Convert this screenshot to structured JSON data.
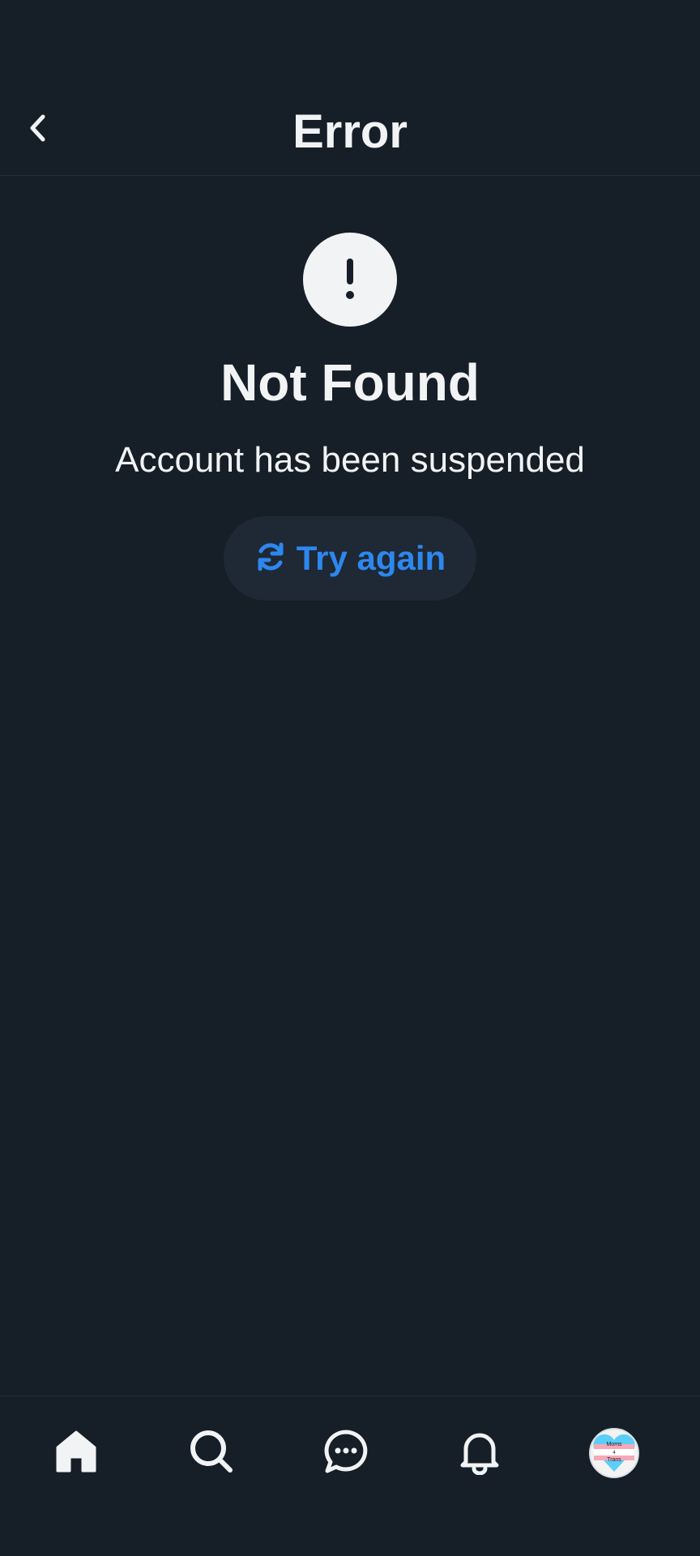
{
  "header": {
    "title": "Error"
  },
  "error": {
    "heading": "Not Found",
    "message": "Account has been suspended",
    "retry_label": "Try again"
  },
  "nav": {
    "items": [
      {
        "name": "home",
        "icon": "home-icon"
      },
      {
        "name": "search",
        "icon": "search-icon"
      },
      {
        "name": "messages",
        "icon": "chat-bubble-icon"
      },
      {
        "name": "notifications",
        "icon": "bell-icon"
      },
      {
        "name": "profile",
        "icon": "avatar"
      }
    ],
    "avatar_text": [
      "Moms",
      "4",
      "Trans"
    ]
  },
  "colors": {
    "background": "#161e27",
    "accent": "#2e87ee",
    "button_bg": "#1e2935",
    "text": "#f1f3f5"
  }
}
